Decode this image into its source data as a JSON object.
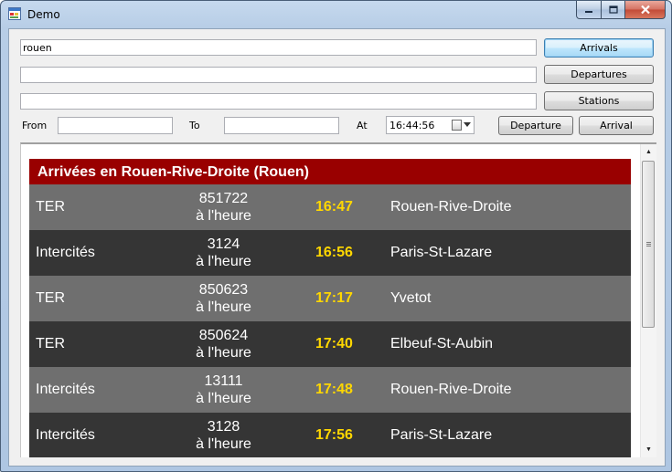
{
  "window": {
    "title": "Demo"
  },
  "search": {
    "value": "rouen",
    "field2_value": "",
    "field3_value": ""
  },
  "buttons": {
    "arrivals": "Arrivals",
    "departures": "Departures",
    "stations": "Stations",
    "departure": "Departure",
    "arrival": "Arrival"
  },
  "route": {
    "from_label": "From",
    "from_value": "",
    "to_label": "To",
    "to_value": "",
    "at_label": "At",
    "time_value": "16:44:56"
  },
  "board": {
    "title": "Arrivées en Rouen-Rive-Droite (Rouen)",
    "rows": [
      {
        "type": "TER",
        "number": "851722",
        "status": "à l'heure",
        "time": "16:47",
        "destination": "Rouen-Rive-Droite"
      },
      {
        "type": "Intercités",
        "number": "3124",
        "status": "à l'heure",
        "time": "16:56",
        "destination": "Paris-St-Lazare"
      },
      {
        "type": "TER",
        "number": "850623",
        "status": "à l'heure",
        "time": "17:17",
        "destination": "Yvetot"
      },
      {
        "type": "TER",
        "number": "850624",
        "status": "à l'heure",
        "time": "17:40",
        "destination": "Elbeuf-St-Aubin"
      },
      {
        "type": "Intercités",
        "number": "13111",
        "status": "à l'heure",
        "time": "17:48",
        "destination": "Rouen-Rive-Droite"
      },
      {
        "type": "Intercités",
        "number": "3128",
        "status": "à l'heure",
        "time": "17:56",
        "destination": "Paris-St-Lazare"
      }
    ]
  },
  "colors": {
    "header_bg": "#990000",
    "row_light": "#6f6f6f",
    "row_dark": "#353535",
    "time_color": "#ffd700"
  },
  "icons": {
    "app": "app-window-icon",
    "minimize": "minimize-icon",
    "maximize": "maximize-icon",
    "close": "close-icon",
    "calendar": "calendar-icon"
  }
}
